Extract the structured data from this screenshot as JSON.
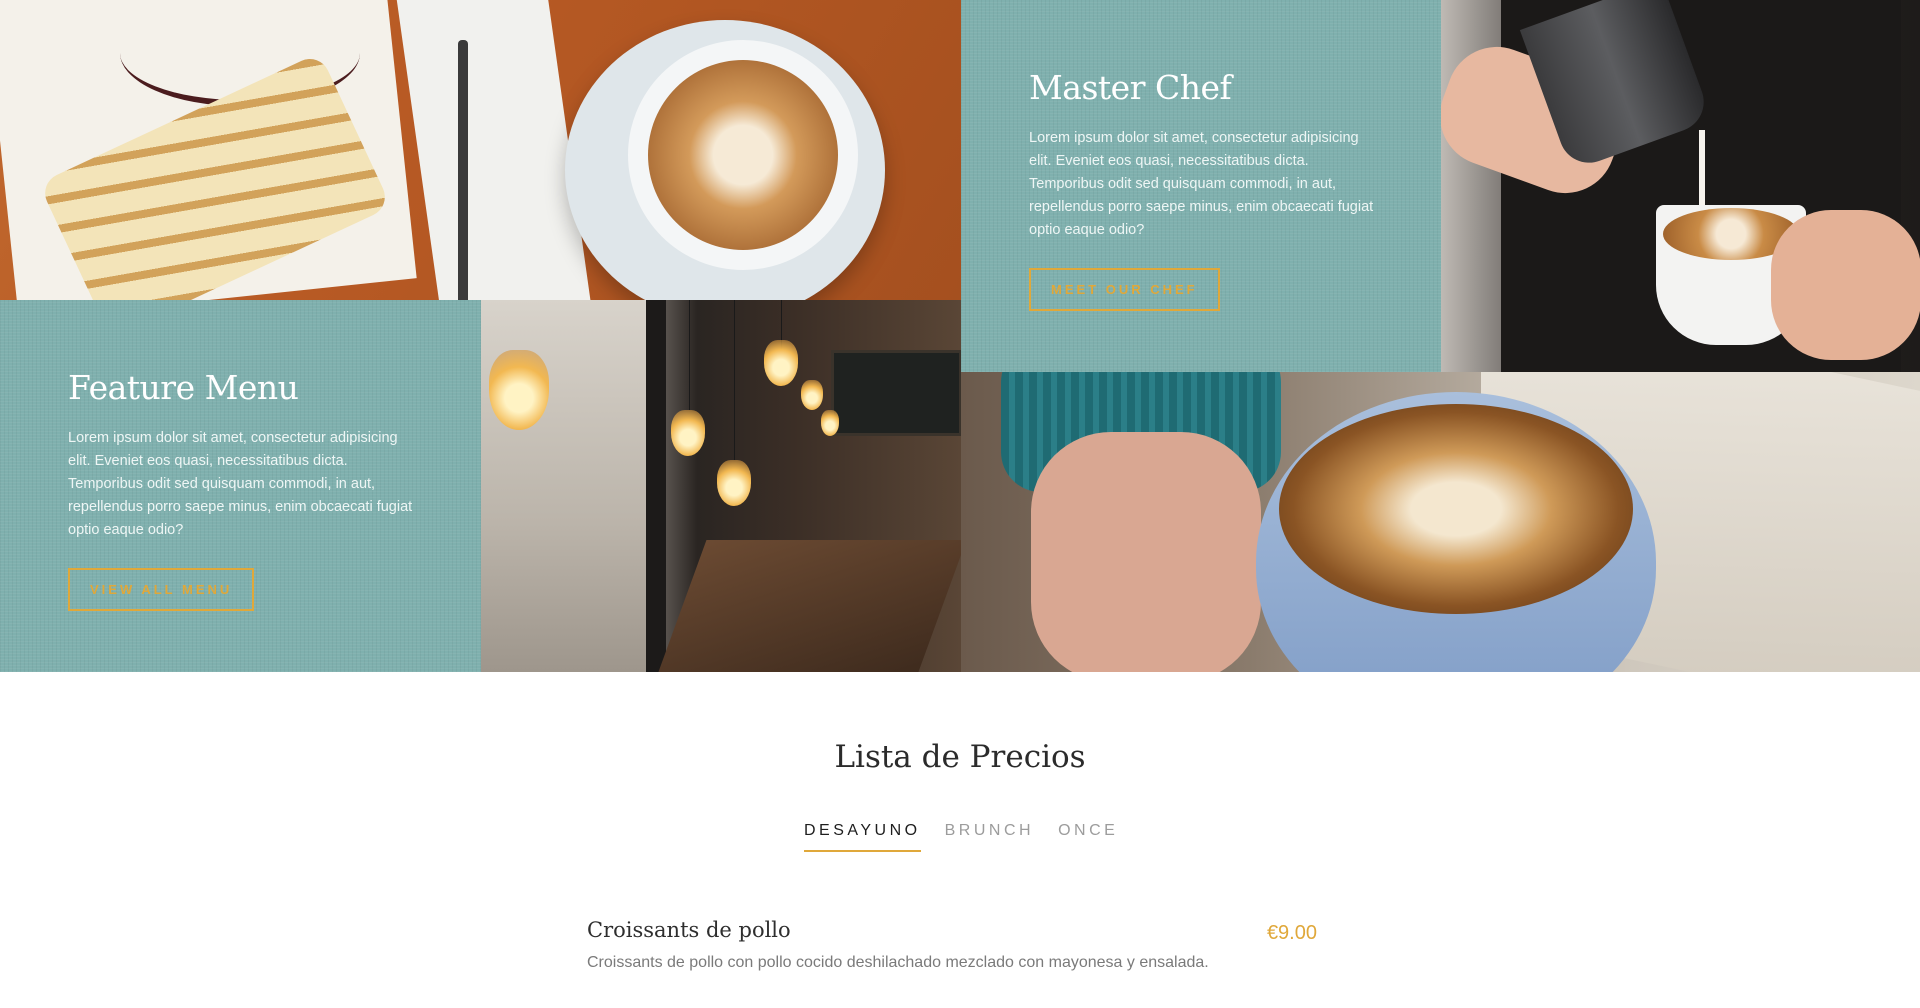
{
  "colors": {
    "accent": "#e0a83a",
    "panel_teal": "#7fb0ae",
    "heading_dark": "#2b2b2b",
    "muted_text": "#7a7a7a"
  },
  "feature_menu": {
    "title": "Feature Menu",
    "body": "Lorem ipsum dolor sit amet, consectetur adipisicing elit. Eveniet eos quasi, necessitatibus dicta. Temporibus odit sed quisquam commodi, in aut, repellendus porro saepe minus, enim obcaecati fugiat optio eaque odio?",
    "button_label": "VIEW ALL MENU"
  },
  "master_chef": {
    "title": "Master Chef",
    "body": "Lorem ipsum dolor sit amet, consectetur adipisicing elit. Eveniet eos quasi, necessitatibus dicta. Temporibus odit sed quisquam commodi, in aut, repellendus porro saepe minus, enim obcaecati fugiat optio eaque odio?",
    "button_label": "MEET OUR CHEF"
  },
  "price_list": {
    "title": "Lista de Precios",
    "tabs": [
      {
        "label": "DESAYUNO",
        "active": true
      },
      {
        "label": "BRUNCH",
        "active": false
      },
      {
        "label": "ONCE",
        "active": false
      }
    ],
    "items": [
      {
        "name": "Croissants de pollo",
        "description": "Croissants de pollo con pollo cocido deshilachado mezclado con mayonesa y ensalada.",
        "price": "€9.00"
      }
    ]
  }
}
